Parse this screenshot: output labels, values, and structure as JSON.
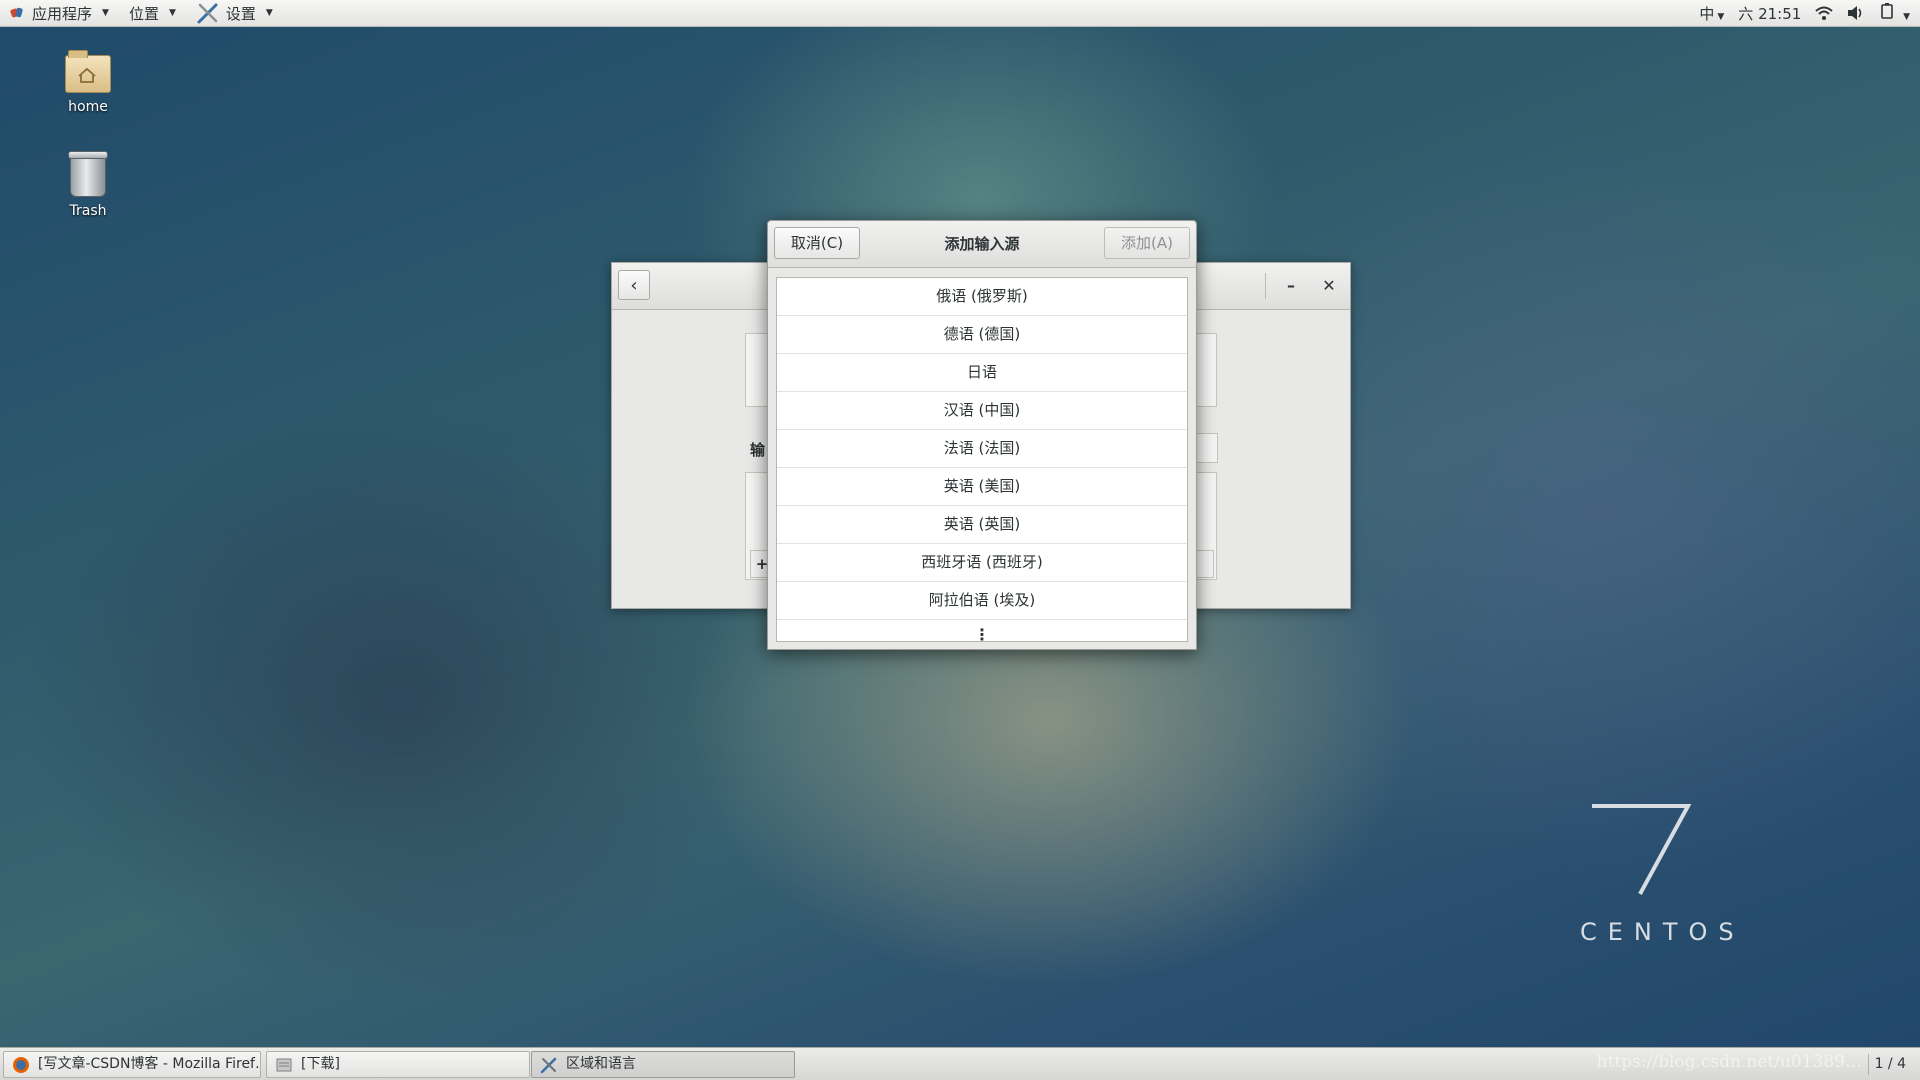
{
  "top_panel": {
    "applications_label": "应用程序",
    "places_label": "位置",
    "settings_label": "设置",
    "input_method": "中",
    "clock": "六 21:51"
  },
  "desktop": {
    "icons": [
      {
        "label": "home",
        "icon": "home-folder-icon"
      },
      {
        "label": "Trash",
        "icon": "trash-icon"
      }
    ]
  },
  "background_window": {
    "partial_label": "输"
  },
  "dialog": {
    "title": "添加输入源",
    "cancel_label": "取消(C)",
    "add_label": "添加(A)",
    "languages": [
      "俄语 (俄罗斯)",
      "德语 (德国)",
      "日语",
      "汉语 (中国)",
      "法语 (法国)",
      "英语 (美国)",
      "英语 (英国)",
      "西班牙语 (西班牙)",
      "阿拉伯语 (埃及)"
    ],
    "more_label": "⋮"
  },
  "branding": {
    "version": "7",
    "name": "CENTOS"
  },
  "taskbar": {
    "tasks": [
      {
        "label": "[写文章-CSDN博客 - Mozilla Firef…",
        "icon": "firefox-icon"
      },
      {
        "label": "[下载]",
        "icon": "file-manager-icon"
      },
      {
        "label": "区域和语言",
        "icon": "settings-tools-icon"
      }
    ],
    "workspace": "1 / 4",
    "watermark": "https://blog.csdn.net/u01389…"
  },
  "colors": {
    "panel": "#e8e8e7",
    "accent": "#3b6ea5"
  }
}
